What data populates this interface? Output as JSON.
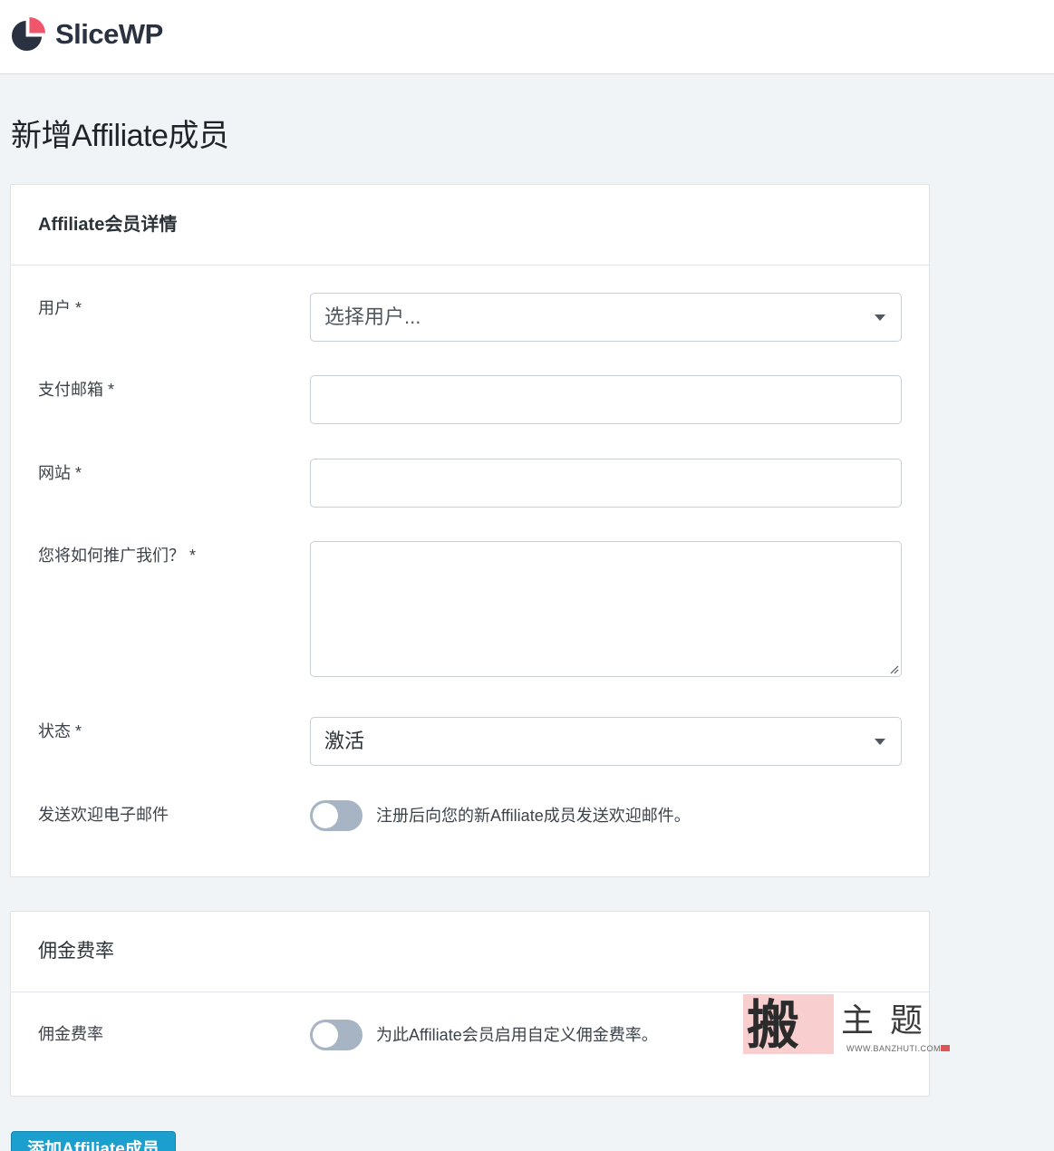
{
  "brand": {
    "name": "SliceWP",
    "icon": "pie-logo-icon",
    "accent": "#f0566b",
    "dark": "#2a3140"
  },
  "page": {
    "title": "新增Affiliate成员"
  },
  "details_card": {
    "title": "Affiliate会员详情",
    "user": {
      "label": "用户 *",
      "placeholder": "选择用户..."
    },
    "payment_email": {
      "label": "支付邮箱 *",
      "value": ""
    },
    "website": {
      "label": "网站 *",
      "value": ""
    },
    "promotion": {
      "label": "您将如何推广我们？ *",
      "value": ""
    },
    "status": {
      "label": "状态 *",
      "value": "激活"
    },
    "welcome_email": {
      "label": "发送欢迎电子邮件",
      "toggle_on": false,
      "description": "注册后向您的新Affiliate成员发送欢迎邮件。"
    }
  },
  "commission_card": {
    "title": "佣金费率",
    "rate": {
      "label": "佣金费率",
      "toggle_on": false,
      "description": "为此Affiliate会员启用自定义佣金费率。"
    }
  },
  "watermark": {
    "char": "搬",
    "title": "主题",
    "url": "WWW.BANZHUTI.COM"
  },
  "actions": {
    "submit_label": "添加Affiliate成员"
  }
}
